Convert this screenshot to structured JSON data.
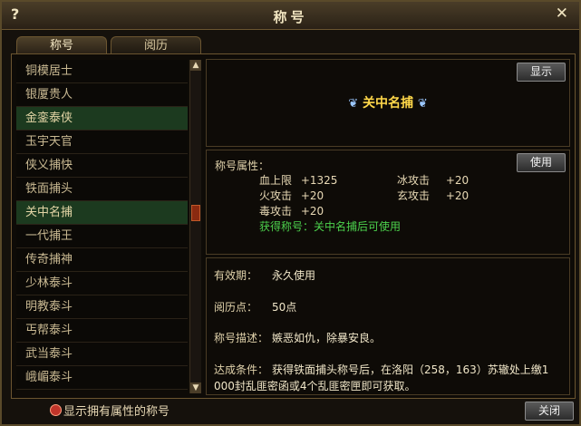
{
  "window": {
    "title": "称号",
    "help_glyph": "?",
    "close_glyph": "✕"
  },
  "tabs": [
    {
      "label": "称号"
    },
    {
      "label": "阅历"
    }
  ],
  "list": {
    "items": [
      {
        "label": "铜模居士"
      },
      {
        "label": "银厦贵人"
      },
      {
        "label": "金銮泰侠"
      },
      {
        "label": "玉宇天官"
      },
      {
        "label": "侠义捕快"
      },
      {
        "label": "铁面捕头"
      },
      {
        "label": "关中名捕"
      },
      {
        "label": "一代捕王"
      },
      {
        "label": "传奇捕神"
      },
      {
        "label": "少林泰斗"
      },
      {
        "label": "明教泰斗"
      },
      {
        "label": "丐帮泰斗"
      },
      {
        "label": "武当泰斗"
      },
      {
        "label": "峨嵋泰斗"
      }
    ],
    "scroll_up": "▲",
    "scroll_down": "▼"
  },
  "display": {
    "button": "显示",
    "title_name": "关中名捕",
    "wing_left": "❦",
    "wing_right": "❦"
  },
  "attributes": {
    "label": "称号属性：",
    "use_button": "使用",
    "rows": [
      {
        "name": "血上限",
        "value": "+1325"
      },
      {
        "name": "冰攻击",
        "value": "+20"
      },
      {
        "name": "火攻击",
        "value": "+20"
      },
      {
        "name": "玄攻击",
        "value": "+20"
      },
      {
        "name": "毒攻击",
        "value": "+20"
      }
    ],
    "obtain": "获得称号：关中名捕后可使用"
  },
  "info": {
    "validity_label": "有效期：",
    "validity_value": "永久使用",
    "points_label": "阅历点：",
    "points_value": "50点",
    "desc_label": "称号描述：",
    "desc_value": "嫉恶如仇，除暴安良。",
    "cond_label": "达成条件：",
    "cond_line1": "获得铁面捕头称号后，在洛阳（258，163）苏辙处上缴1",
    "cond_line2": "000封乱匪密函或4个乱匪密匣即可获取。"
  },
  "footer": {
    "checkbox_label": "显示拥有属性的称号",
    "close_button": "关闭"
  }
}
